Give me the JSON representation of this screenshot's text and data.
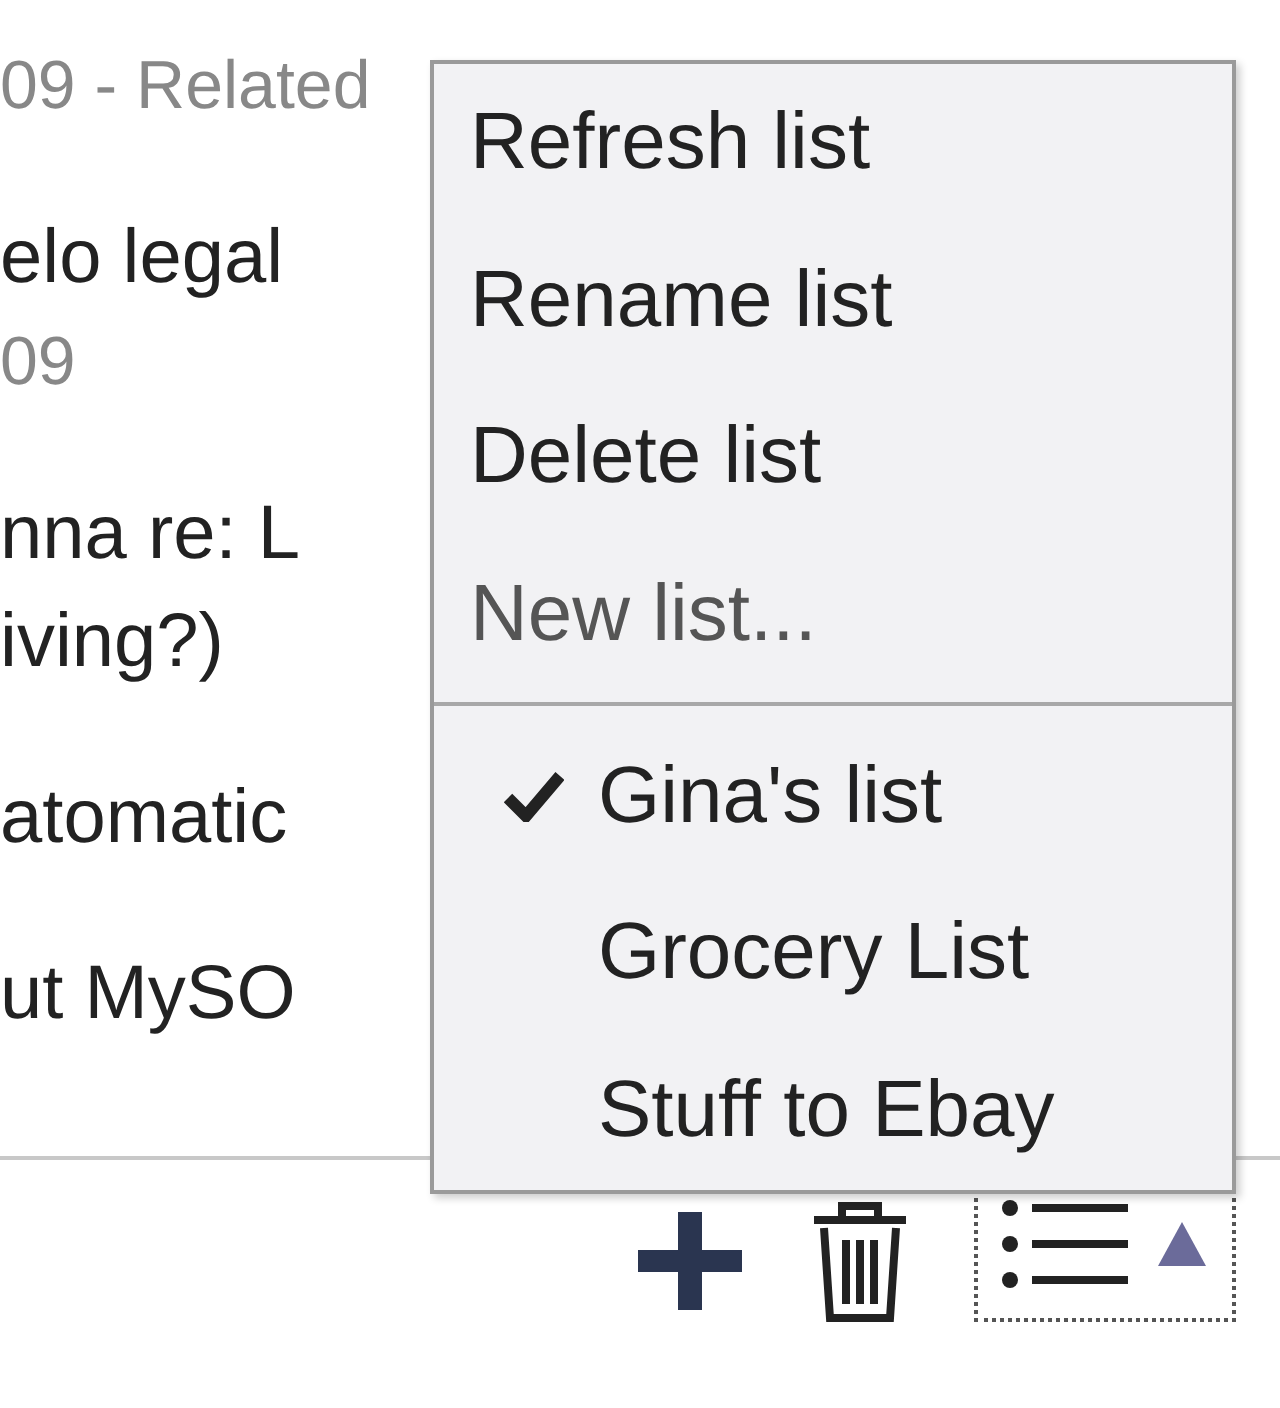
{
  "tasks": [
    {
      "lines": [
        {
          "kind": "meta",
          "text": "09 - Related"
        }
      ]
    },
    {
      "lines": [
        {
          "kind": "title",
          "text": "elo legal"
        },
        {
          "kind": "meta",
          "text": "09"
        }
      ]
    },
    {
      "lines": [
        {
          "kind": "title",
          "text": "nna re: L"
        },
        {
          "kind": "title",
          "text": "iving?)"
        }
      ]
    },
    {
      "lines": [
        {
          "kind": "title",
          "text": "atomatic"
        }
      ]
    },
    {
      "lines": [
        {
          "kind": "title",
          "text": "ut MySO"
        }
      ]
    }
  ],
  "menu": {
    "actions": [
      {
        "label": "Refresh list",
        "disabled": false
      },
      {
        "label": "Rename list",
        "disabled": false
      },
      {
        "label": "Delete list",
        "disabled": false
      },
      {
        "label": "New list...",
        "disabled": true
      }
    ],
    "lists": [
      {
        "label": "Gina's list",
        "selected": true
      },
      {
        "label": "Grocery List",
        "selected": false
      },
      {
        "label": "Stuff to Ebay",
        "selected": false
      }
    ]
  }
}
